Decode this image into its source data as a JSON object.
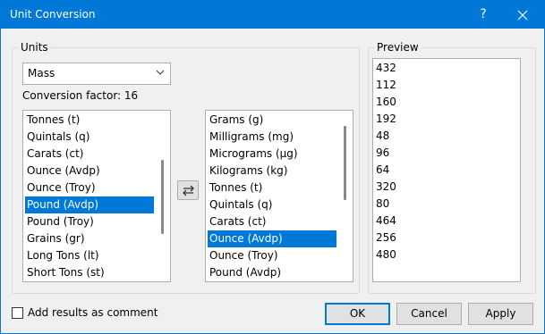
{
  "window": {
    "title": "Unit Conversion",
    "help_label": "?",
    "close_label": "✕",
    "accent_color": "#0078d7"
  },
  "units": {
    "group_label": "Units",
    "category": "Mass",
    "conversion_factor": "Conversion factor: 16",
    "from_list": [
      "Tonnes (t)",
      "Quintals (q)",
      "Carats (ct)",
      "Ounce (Avdp)",
      "Ounce (Troy)",
      "Pound (Avdp)",
      "Pound (Troy)",
      "Grains (gr)",
      "Long Tons (lt)",
      "Short Tons (st)"
    ],
    "from_selected": "Pound (Avdp)",
    "to_list": [
      "Grams (g)",
      "Milligrams (mg)",
      "Micrograms (µg)",
      "Kilograms (kg)",
      "Tonnes (t)",
      "Quintals (q)",
      "Carats (ct)",
      "Ounce (Avdp)",
      "Ounce (Troy)",
      "Pound (Avdp)"
    ],
    "to_selected": "Ounce (Avdp)",
    "swap_icon": "swap-arrows-icon"
  },
  "preview": {
    "group_label": "Preview",
    "values": [
      "432",
      "112",
      "160",
      "192",
      "48",
      "96",
      "64",
      "320",
      "80",
      "464",
      "256",
      "480"
    ]
  },
  "footer": {
    "add_comment_label": "Add results as comment",
    "add_comment_checked": false,
    "ok_label": "OK",
    "cancel_label": "Cancel",
    "apply_label": "Apply"
  }
}
